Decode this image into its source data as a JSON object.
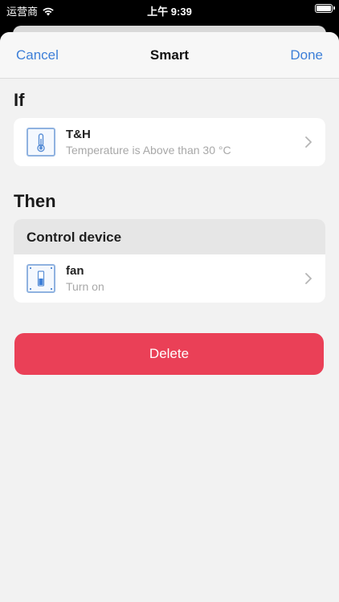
{
  "status_bar": {
    "carrier": "运营商",
    "time": "上午 9:39"
  },
  "nav": {
    "cancel_label": "Cancel",
    "title": "Smart",
    "done_label": "Done"
  },
  "if_section": {
    "title": "If",
    "condition": {
      "name": "T&H",
      "description": "Temperature is Above than 30 °C",
      "icon": "thermometer-icon"
    }
  },
  "then_section": {
    "title": "Then",
    "header": "Control device",
    "action": {
      "name": "fan",
      "description": "Turn on",
      "icon": "switch-icon"
    }
  },
  "delete_label": "Delete",
  "colors": {
    "accent": "#3d7fd8",
    "danger": "#ea4057",
    "background": "#f2f2f2"
  }
}
